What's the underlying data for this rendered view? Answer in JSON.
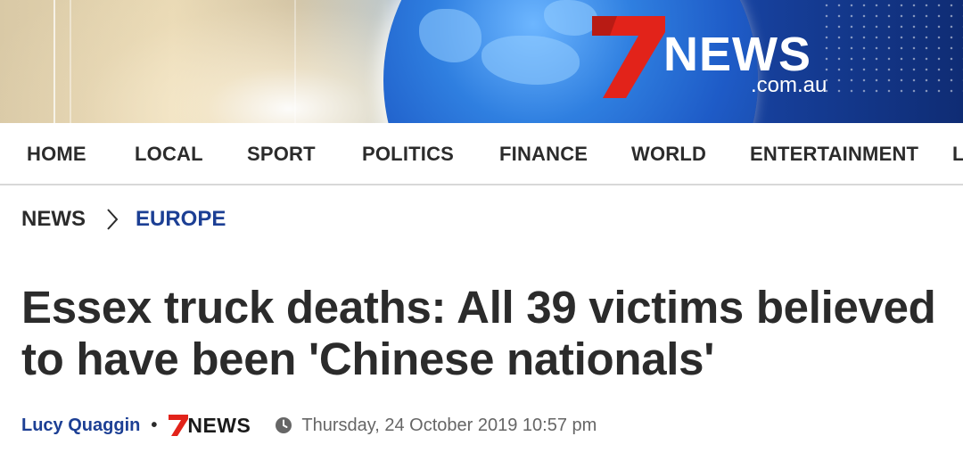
{
  "brand": {
    "logo_word": "NEWS",
    "logo_domain": ".com.au",
    "logo_mark": "7",
    "colors": {
      "seven_red": "#e2231a",
      "primary_blue": "#1c3f94",
      "text_dark": "#2b2b2b",
      "meta_gray": "#666666"
    }
  },
  "nav": {
    "items": [
      "HOME",
      "LOCAL",
      "SPORT",
      "POLITICS",
      "FINANCE",
      "WORLD",
      "ENTERTAINMENT",
      "L"
    ]
  },
  "breadcrumb": {
    "parent": "NEWS",
    "separator_icon": "chevron-right-icon",
    "current": "EUROPE"
  },
  "article": {
    "headline": "Essex truck deaths: All 39 victims believed to have been 'Chinese nationals'",
    "author": "Lucy Quaggin",
    "byline_separator": "•",
    "source_logo_word": "NEWS",
    "clock_icon": "clock-icon",
    "timestamp": "Thursday, 24 October 2019 10:57 pm"
  }
}
